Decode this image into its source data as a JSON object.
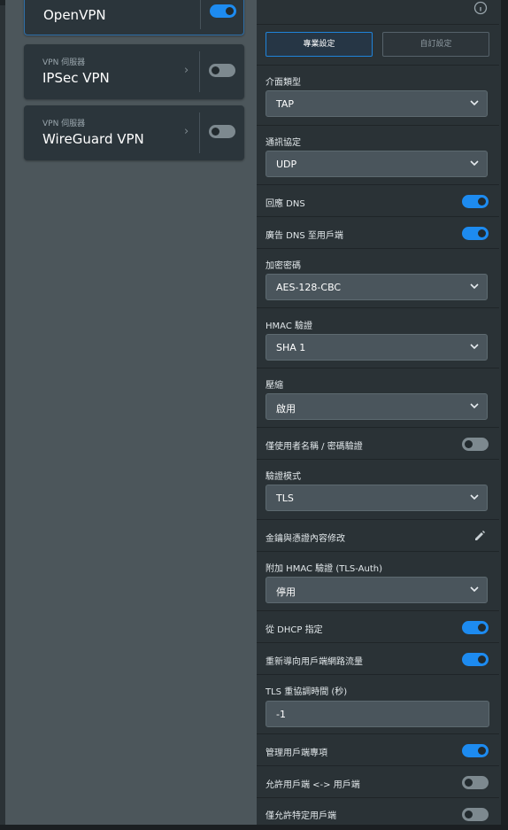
{
  "left_cards": [
    {
      "subtitle": "",
      "name": "OpenVPN",
      "enabled": true
    },
    {
      "subtitle": "VPN 伺服器",
      "name": "IPSec VPN",
      "enabled": false
    },
    {
      "subtitle": "VPN 伺服器",
      "name": "WireGuard VPN",
      "enabled": false
    }
  ],
  "tabs": {
    "professional": "專業設定",
    "custom": "自訂設定"
  },
  "settings": {
    "interface_type": {
      "label": "介面類型",
      "value": "TAP"
    },
    "protocol": {
      "label": "通訊協定",
      "value": "UDP"
    },
    "respond_dns": {
      "label": "回應 DNS",
      "enabled": true
    },
    "advertise_dns": {
      "label": "廣告 DNS 至用戶端",
      "enabled": true
    },
    "cipher": {
      "label": "加密密碼",
      "value": "AES-128-CBC"
    },
    "hmac_auth": {
      "label": "HMAC 驗證",
      "value": "SHA 1"
    },
    "compression": {
      "label": "壓縮",
      "value": "啟用"
    },
    "username_password_only": {
      "label": "僅使用者名稱 / 密碼驗證",
      "enabled": false
    },
    "auth_mode": {
      "label": "驗證模式",
      "value": "TLS"
    },
    "keys_certs": {
      "label": "金鑰與憑證內容修改"
    },
    "extra_hmac": {
      "label": "附加 HMAC 驗證 (TLS-Auth)",
      "value": "停用"
    },
    "dhcp": {
      "label": "從 DHCP 指定",
      "enabled": true
    },
    "redirect_traffic": {
      "label": "重新導向用戶端網路流量",
      "enabled": true
    },
    "tls_renegotiation": {
      "label": "TLS 重協調時間 (秒)",
      "value": "-1"
    },
    "manage_client_options": {
      "label": "管理用戶端專項",
      "enabled": true
    },
    "allow_client_to_client": {
      "label": "允許用戶端 <-> 用戶端",
      "enabled": false
    },
    "allow_specific_clients": {
      "label": "僅允許特定用戶端",
      "enabled": false
    }
  },
  "colors": {
    "accent": "#1d8bf0",
    "panel": "#2a3236",
    "sidebar": "#4c565b"
  },
  "icons": {
    "arrow": "chevron-down-icon",
    "edit": "pencil-icon",
    "info": "info-icon"
  }
}
